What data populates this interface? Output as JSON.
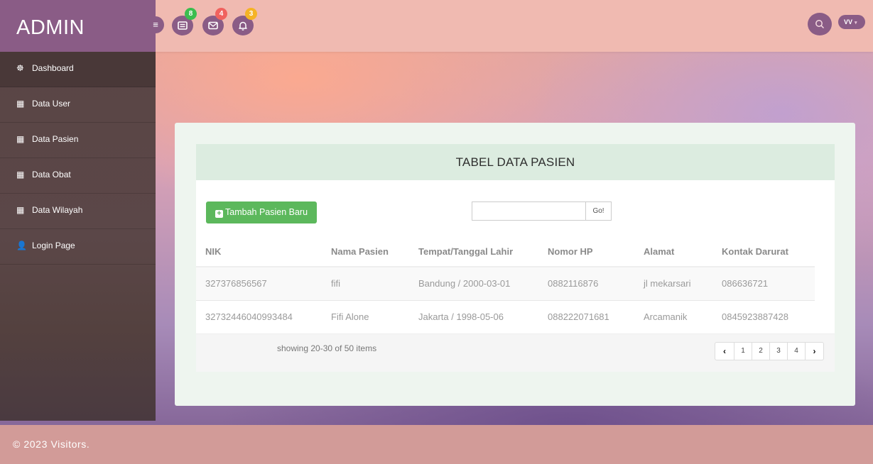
{
  "brand": "ADMIN",
  "topbar": {
    "menu_icon": "hamburger-icon",
    "icons": [
      {
        "name": "tasks-icon",
        "badge": "8",
        "badge_color": "#3bbd4f"
      },
      {
        "name": "envelope-icon",
        "badge": "4",
        "badge_color": "#f0625e"
      },
      {
        "name": "bell-icon",
        "badge": "3",
        "badge_color": "#f5b325"
      }
    ],
    "search_icon": "search-icon",
    "user_initials": "VV",
    "user_caret": "▾"
  },
  "sidebar": {
    "items": [
      {
        "label": "Dashboard",
        "icon": "dashboard-icon",
        "glyph": "☸"
      },
      {
        "label": "Data User",
        "icon": "table-icon",
        "glyph": "▦"
      },
      {
        "label": "Data Pasien",
        "icon": "table-icon",
        "glyph": "▦"
      },
      {
        "label": "Data Obat",
        "icon": "table-icon",
        "glyph": "▦"
      },
      {
        "label": "Data Wilayah",
        "icon": "table-icon",
        "glyph": "▦"
      },
      {
        "label": "Login Page",
        "icon": "user-icon",
        "glyph": "👤"
      }
    ]
  },
  "panel": {
    "title": "TABEL DATA PASIEN",
    "add_button": "Tambah Pasien Baru",
    "search_value": "",
    "go_button": "Go!",
    "columns": [
      "NIK",
      "Nama Pasien",
      "Tempat/Tanggal Lahir",
      "Nomor HP",
      "Alamat",
      "Kontak Darurat"
    ],
    "rows": [
      [
        "327376856567",
        "fifi",
        "Bandung / 2000-03-01",
        "0882116876",
        "jl mekarsari",
        "086636721"
      ],
      [
        "32732446040993484",
        "Fifi Alone",
        "Jakarta / 1998-05-06",
        "088222071681",
        "Arcamanik",
        "0845923887428"
      ]
    ],
    "showing": "showing 20-30 of 50 items",
    "pagination": {
      "prev": "‹",
      "pages": [
        "1",
        "2",
        "3",
        "4"
      ],
      "next": "›"
    }
  },
  "footer": "© 2023 Visitors.",
  "colors": {
    "accent": "#8a5c86",
    "topbar": "#f0bab1",
    "button_green": "#5cb85c",
    "footer": "#d29b98"
  }
}
